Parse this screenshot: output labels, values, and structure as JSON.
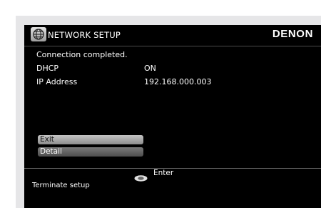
{
  "header": {
    "icon": "globe-network-icon",
    "title": "NETWORK SETUP",
    "brand": "DENON"
  },
  "info": {
    "status": "Connection completed.",
    "dhcp_label": "DHCP",
    "dhcp_value": "ON",
    "ip_label": "IP Address",
    "ip_value": "192.168.000.003"
  },
  "menu": {
    "items": [
      {
        "label": "Exit",
        "selected": true
      },
      {
        "label": "Detail",
        "selected": false
      }
    ]
  },
  "footer": {
    "enter_icon": "enter-button-icon",
    "enter_label": "Enter",
    "hint": "Terminate setup"
  },
  "colors": {
    "background": "#000000",
    "bezel": "#e6e6e8",
    "text": "#ffffff",
    "selected_item": "#b0b0b0",
    "item": "#606060"
  }
}
